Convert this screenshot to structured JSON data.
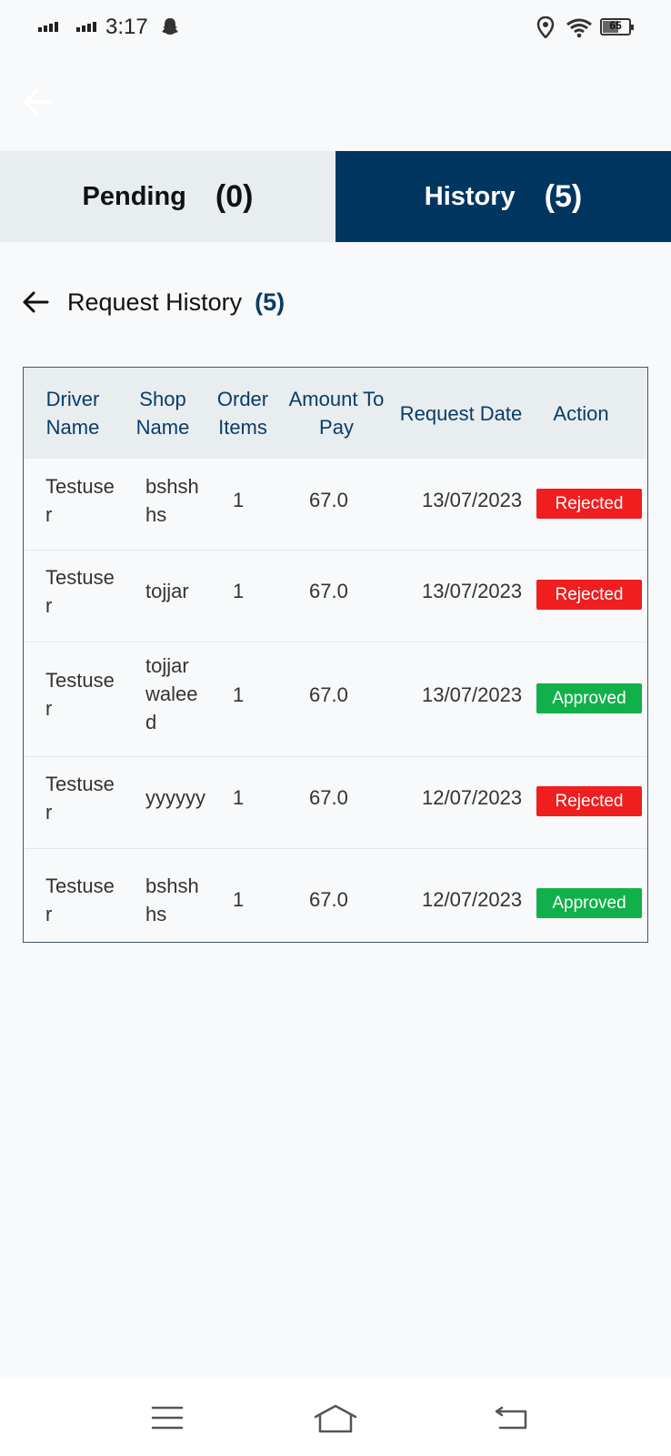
{
  "status_bar": {
    "time": "3:17",
    "battery": "65"
  },
  "tabs": [
    {
      "label": "Pending",
      "count": "(0)",
      "active": false
    },
    {
      "label": "History",
      "count": "(5)",
      "active": true
    }
  ],
  "section": {
    "title": "Request History",
    "count": "(5)"
  },
  "table": {
    "headers": [
      {
        "line1": "Driver",
        "line2": "Name"
      },
      {
        "line1": "Shop",
        "line2": "Name"
      },
      {
        "line1": "Order",
        "line2": "Items"
      },
      {
        "line1": "Amount To",
        "line2": "Pay"
      },
      {
        "line1": "Request Date",
        "line2": ""
      },
      {
        "line1": "Action",
        "line2": ""
      }
    ],
    "rows": [
      {
        "driver": "Testuser",
        "shop": "bshshhs",
        "items": "1",
        "amount": "67.0",
        "date": "13/07/2023",
        "status": "Rejected"
      },
      {
        "driver": "Testuser",
        "shop": "tojjar",
        "items": "1",
        "amount": "67.0",
        "date": "13/07/2023",
        "status": "Rejected"
      },
      {
        "driver": "Testuser",
        "shop": "tojjar waleed",
        "items": "1",
        "amount": "67.0",
        "date": "13/07/2023",
        "status": "Approved"
      },
      {
        "driver": "Testuser",
        "shop": "yyyyyy",
        "items": "1",
        "amount": "67.0",
        "date": "12/07/2023",
        "status": "Rejected"
      },
      {
        "driver": "Testuser",
        "shop": "bshshhs",
        "items": "1",
        "amount": "67.0",
        "date": "12/07/2023",
        "status": "Approved"
      }
    ]
  },
  "colors": {
    "primary": "#003660",
    "accent_text": "#0a3c66",
    "rejected": "#f01e1e",
    "approved": "#12b04a",
    "tab_inactive": "#e8edf0"
  },
  "icons": {
    "top_back": "arrow-left-icon",
    "section_back": "arrow-left-icon",
    "nav": [
      "menu-icon",
      "home-icon",
      "back-icon"
    ]
  }
}
